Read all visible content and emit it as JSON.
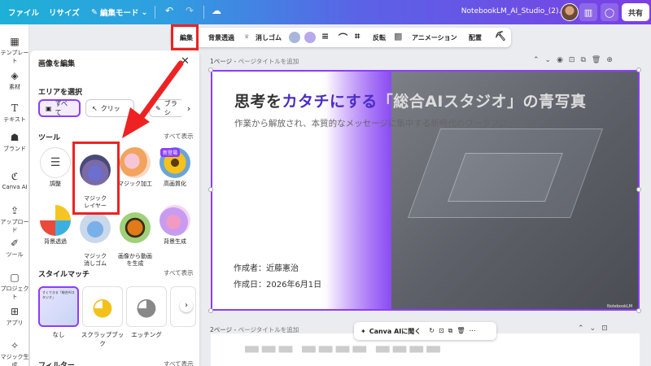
{
  "topbar": {
    "file": "ファイル",
    "resize": "リサイズ",
    "mode": "編集モード",
    "document_name": "NotebookLM_AI_Studio_(2).pdf",
    "share": "共有"
  },
  "rail": [
    {
      "label": "テンプレート",
      "icon": "template-icon"
    },
    {
      "label": "素材",
      "icon": "elements-icon"
    },
    {
      "label": "テキスト",
      "icon": "text-icon"
    },
    {
      "label": "ブランド",
      "icon": "brand-icon"
    },
    {
      "label": "Canva AI",
      "icon": "canva-ai-icon"
    },
    {
      "label": "アップロード",
      "icon": "upload-icon"
    },
    {
      "label": "ツール",
      "icon": "tools-icon"
    },
    {
      "label": "プロジェクト",
      "icon": "projects-icon"
    },
    {
      "label": "アプリ",
      "icon": "apps-icon"
    },
    {
      "label": "マジック生成",
      "icon": "magic-generate-icon"
    }
  ],
  "panel": {
    "title": "画像を編集",
    "area_heading": "エリアを選択",
    "area_chips": [
      "すべて",
      "クリッ",
      "ブラシ"
    ],
    "tools_heading": "ツール",
    "show_all": "すべて表示",
    "new_badge": "新登場",
    "tools": [
      {
        "label": "調整"
      },
      {
        "label": "マジック\nレイヤー"
      },
      {
        "label": "マジック加工"
      },
      {
        "label": "高画質化"
      },
      {
        "label": "背景透過"
      },
      {
        "label": "マジック\n消しゴム"
      },
      {
        "label": "画像から動画\nを生成"
      },
      {
        "label": "背景生成"
      }
    ],
    "stylematch_heading": "スタイルマッチ",
    "stylematch_showall": "すべて表示",
    "thumb_text": "すくできる「総合AIスタジオ」",
    "styles": [
      {
        "label": "なし"
      },
      {
        "label": "スクラップブック"
      },
      {
        "label": "エッチング"
      }
    ],
    "filter_heading": "フィルター",
    "filter_showall": "すべて表示"
  },
  "toolbar": {
    "edit": "編集",
    "bg_remove": "背景透過",
    "eraser": "消しゴム",
    "flip": "反転",
    "animation": "アニメーション",
    "arrange": "配置",
    "swatches": [
      "#a9b6dc",
      "#b8a8ee"
    ]
  },
  "canvas": {
    "page1_label": "1ページ",
    "page2_label": "2ページ",
    "page_title_placeholder": "ページタイトルを追加",
    "slide": {
      "title_a": "思考を",
      "title_b": "カタチにする",
      "title_c": "「総合AIスタジオ」の青写真",
      "subtitle": "作業から解放され、本質的なメッセージに集中する新時代のワークフロー",
      "author": "作成者：近藤憲治",
      "date": "作成日：2026年6月1日",
      "watermark": "NotebookLM"
    },
    "canva_ai_button": "Canva AIに聞く"
  },
  "colors": {
    "accent": "#8b3dff",
    "annotation": "#ee2222"
  }
}
